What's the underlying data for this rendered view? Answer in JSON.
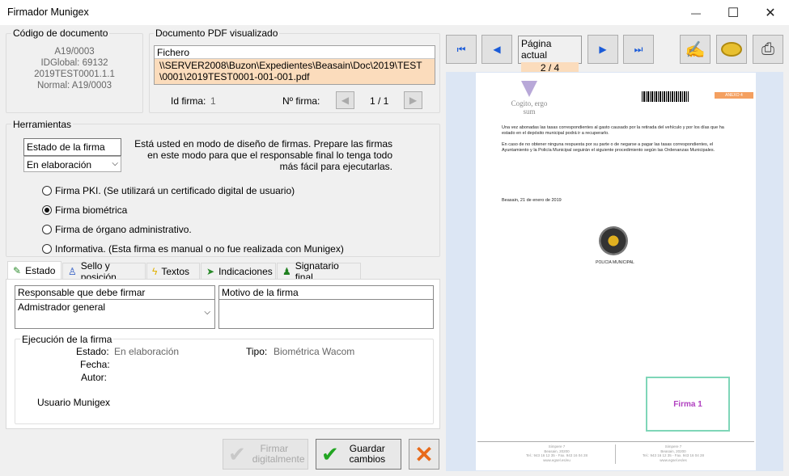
{
  "window": {
    "title": "Firmador Munigex",
    "minimize": "—",
    "maximize": "☐",
    "close": "✕"
  },
  "doc_code": {
    "group_label": "Código de documento",
    "line1": "A19/0003",
    "line2": "IDGlobal: 69132",
    "line3": "2019TEST0001.1.1",
    "line4": "Normal: A19/0003"
  },
  "pdf_group": {
    "label": "Documento PDF visualizado",
    "fichero_label": "Fichero",
    "path": "\\\\SERVER2008\\Buzon\\Expedientes\\Beasain\\Doc\\2019\\TEST\n\\0001\\2019TEST0001-001-001.pdf",
    "idfirma_label": "Id firma:",
    "idfirma_value": "1",
    "nfirma_label": "Nº firma:",
    "nfirma_value": "1 / 1"
  },
  "tools": {
    "label": "Herramientas",
    "estado_label": "Estado de la firma",
    "estado_value": "En elaboración",
    "info": "Está usted en modo de diseño de firmas. Prepare las firmas en este modo para que el responsable final lo tenga todo más fácil para ejecutarlas.",
    "radios": [
      "Firma PKI. (Se utilizará un certificado digital de usuario)",
      "Firma biométrica",
      "Firma de órgano administrativo.",
      "Informativa. (Esta firma es manual o no fue realizada con Munigex)"
    ]
  },
  "tabs": [
    "Estado",
    "Sello y posición",
    "Textos",
    "Indicaciones",
    "Signatario final"
  ],
  "estado_tab": {
    "responsable_label": "Responsable que debe firmar",
    "responsable_value": "Admistrador general",
    "motivo_label": "Motivo de la firma",
    "ejecucion_label": "Ejecución de la firma",
    "estado_label": "Estado:",
    "estado_value": "En elaboración",
    "tipo_label": "Tipo:",
    "tipo_value": "Biométrica Wacom",
    "fecha_label": "Fecha:",
    "autor_label": "Autor:",
    "usuario_label": "Usuario Munigex"
  },
  "actions": {
    "firmar": "Firmar digitalmente",
    "guardar": "Guardar cambios"
  },
  "viewer": {
    "page_label": "Página actual",
    "page_value": "2 / 4"
  },
  "pdf_page": {
    "logo_text": "Cogito, ergo sum",
    "anexo": "ANEXO 4",
    "para1": "Una vez abonadas las tasas correspondientes al gasto causado por la retirada del vehículo y por los días que ha estado en el depósito municipal podrá ir a recuperarlo.",
    "para2": "En caso de no obtener ninguna respuesta por su parte o de negarse a pagar las tasas correspondientes, el Ayuntamiento y la Policía Municipal seguirán el siguiente procedimiento según las Ordenanzas Municipales.",
    "date": "Beasain, 21 de enero de 2019",
    "police": "POLICIA MUNICIPAL",
    "firma_box": "Firma 1",
    "footer_left": "Simpere 7\nBeasain, 20200\nTel.: 943 16 12 35 - Fax. 943 16 04 28\nwww.egsel.es/eu",
    "footer_right": "Simpere 7\nBeasain, 20200\nTel.: 943 16 12 35 - Fax. 943 16 04 28\nwww.egsel.es/es"
  }
}
